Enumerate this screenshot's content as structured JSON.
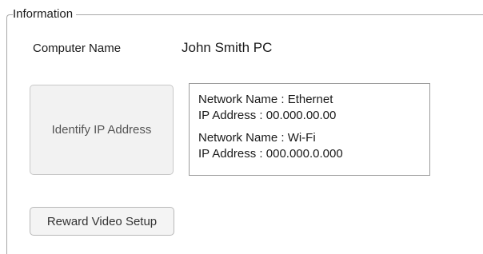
{
  "group": {
    "title": "Information"
  },
  "computer": {
    "label": "Computer Name",
    "value": "John Smith PC"
  },
  "identify_button": {
    "label": "Identify IP Address"
  },
  "network_info": {
    "lines": [
      "Network Name : Ethernet",
      "IP Address : 00.000.00.00",
      "Network Name : Wi-Fi",
      "IP Address : 000.000.0.000"
    ]
  },
  "reward_button": {
    "label": "Reward Video Setup"
  },
  "colors": {
    "border": "#a8a8a8",
    "button_bg": "#f2f2f2",
    "text": "#1a1a1a"
  }
}
